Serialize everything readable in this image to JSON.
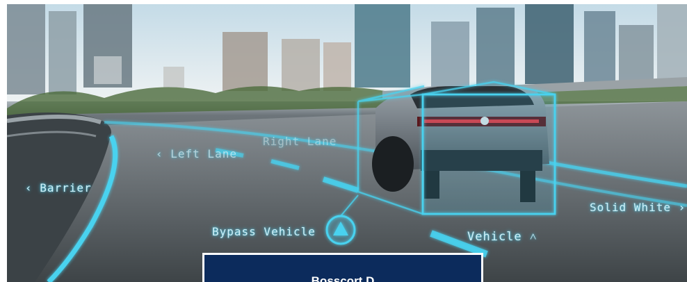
{
  "image": {
    "subject": "ADAS augmented-reality overlay on highway scene",
    "colors": {
      "accent_cyan": "#48d2ef",
      "caption_bg": "#0c2b5c",
      "caption_border": "#ffffff"
    }
  },
  "overlay_labels": {
    "left_lane": "‹ Left Lane",
    "right_lane": "Right Lane",
    "barrier": "‹ Barrier",
    "bypass_vehicle": "Bypass Vehicle",
    "solid_white": "Solid White ›",
    "vehicle": "Vehicle ˄"
  },
  "caption": {
    "text": "Bosscort D"
  }
}
